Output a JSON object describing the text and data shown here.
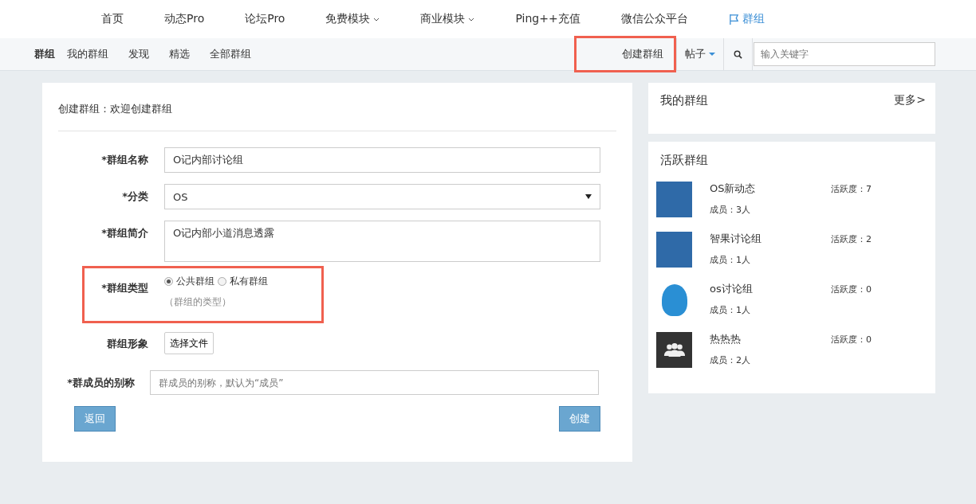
{
  "nav": [
    {
      "label": "首页",
      "dropdown": false,
      "flag": false,
      "selected": false
    },
    {
      "label": "动态Pro",
      "dropdown": false,
      "flag": false,
      "selected": false
    },
    {
      "label": "论坛Pro",
      "dropdown": false,
      "flag": false,
      "selected": false
    },
    {
      "label": "免费模块",
      "dropdown": true,
      "flag": false,
      "selected": false
    },
    {
      "label": "商业模块",
      "dropdown": true,
      "flag": false,
      "selected": false
    },
    {
      "label": "Ping++充值",
      "dropdown": false,
      "flag": false,
      "selected": false
    },
    {
      "label": "微信公众平台",
      "dropdown": false,
      "flag": false,
      "selected": false
    },
    {
      "label": "群组",
      "dropdown": false,
      "flag": true,
      "selected": true
    }
  ],
  "subnav": {
    "items": [
      {
        "label": "群组",
        "selected": true
      },
      {
        "label": "我的群组",
        "selected": false
      },
      {
        "label": "发现",
        "selected": false
      },
      {
        "label": "精选",
        "selected": false
      },
      {
        "label": "全部群组",
        "selected": false
      }
    ],
    "create_button": {
      "label": "创建群组",
      "highlighted": true
    },
    "search_type": "帖子",
    "search_placeholder": "输入关键字"
  },
  "form": {
    "title": "创建群组：欢迎创建群组",
    "fields": [
      {
        "kind": "text",
        "label": "*群组名称",
        "value": "O记内部讨论组"
      },
      {
        "kind": "select",
        "label": "*分类",
        "value": "OS"
      },
      {
        "kind": "textarea",
        "label": "*群组简介",
        "value": "O记内部小道消息透露"
      },
      {
        "kind": "radio",
        "label": "*群组类型",
        "highlighted": true,
        "options": [
          {
            "label": "公共群组",
            "selected": true
          },
          {
            "label": "私有群组",
            "selected": false
          }
        ],
        "hint": "（群组的类型）"
      },
      {
        "kind": "file",
        "label": "群组形象",
        "button": "选择文件"
      },
      {
        "kind": "wide-text",
        "label": "*群成员的别称",
        "placeholder": "群成员的别称，默认为“成员”"
      }
    ],
    "back_button": "返回",
    "submit_button": "创建"
  },
  "my_groups": {
    "title": "我的群组",
    "more": "更多>"
  },
  "active_groups": {
    "title": "活跃群组",
    "items": [
      {
        "kind": "photo",
        "name": "OS新动态",
        "activity": "活跃度：7",
        "members": "成员：3人"
      },
      {
        "kind": "photo",
        "name": "智果讨论组",
        "activity": "活跃度：2",
        "members": "成员：1人"
      },
      {
        "kind": "avatar",
        "name": "os讨论组",
        "activity": "活跃度：0",
        "members": "成员：1人"
      },
      {
        "kind": "icon",
        "name": "热热热",
        "activity": "活跃度：0",
        "members": "成员：2人"
      }
    ]
  }
}
